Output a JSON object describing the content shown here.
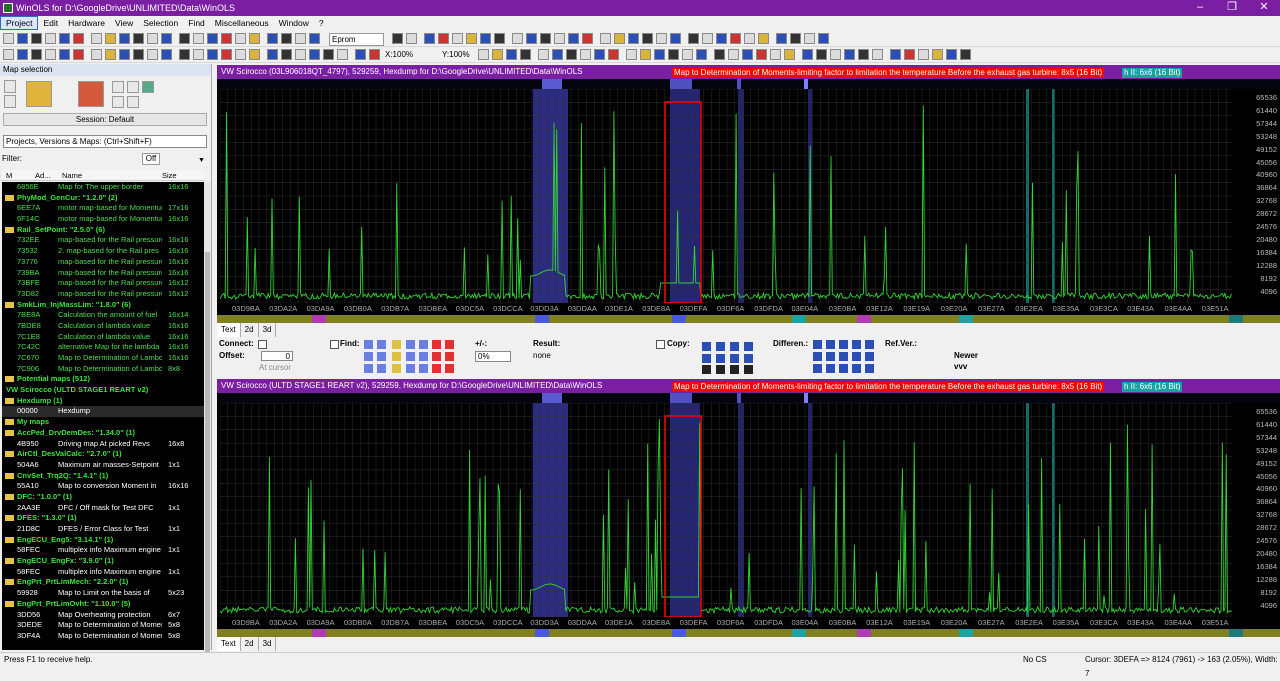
{
  "window": {
    "title": "WinOLS for D:\\GoogleDrive\\UNLIMITED\\Data\\WinOLS",
    "min": "–",
    "max": "❐",
    "close": "✕"
  },
  "menu": [
    "Project",
    "Edit",
    "Hardware",
    "View",
    "Selection",
    "Find",
    "Miscellaneous",
    "Window",
    "?"
  ],
  "toolbar": {
    "eprom": "Eprom",
    "xzoom": "X:100%",
    "yzoom": "Y:100%"
  },
  "left": {
    "header": "Map selection",
    "session": "Session: Default",
    "projsel": "Projects, Versions & Maps:  (Ctrl+Shift+F)",
    "filter_label": "Filter:",
    "filter_off": "Off",
    "cols": {
      "m": "M",
      "addr": "Ad...",
      "name": "Name",
      "size": "Size"
    },
    "rows": [
      {
        "k": "g",
        "a": "6856E",
        "n": "Map for The upper border",
        "s": "16x16"
      },
      {
        "k": "f",
        "t": "PhyMod_GenCur: \"1.2.0\" (2)"
      },
      {
        "k": "g",
        "a": "6EE7A",
        "n": "motor map-based for Momentum",
        "s": "17x16"
      },
      {
        "k": "g",
        "a": "6F14C",
        "n": "motor map-based for Momentum",
        "s": "16x16"
      },
      {
        "k": "f",
        "t": "Rail_SetPoint: \"2.5.0\" (6)"
      },
      {
        "k": "g",
        "a": "732EE",
        "n": "map-based for the Rail pressure",
        "s": "16x16"
      },
      {
        "k": "g",
        "a": "73532",
        "n": "2. map-based for the Rail pres",
        "s": "16x16"
      },
      {
        "k": "g",
        "a": "73776",
        "n": "map-based for the Rail pressure",
        "s": "16x16"
      },
      {
        "k": "g",
        "a": "739BA",
        "n": "map-based for the Rail pressure",
        "s": "16x16"
      },
      {
        "k": "g",
        "a": "73BFE",
        "n": "map-based for the Rail pressure",
        "s": "16x12"
      },
      {
        "k": "g",
        "a": "73D82",
        "n": "map-based for the Rail pressure",
        "s": "16x12"
      },
      {
        "k": "f",
        "t": "SmkLim_InjMassLim: \"1.8.0\" (6)"
      },
      {
        "k": "g",
        "a": "7BE8A",
        "n": "Calculation the amount of fuel",
        "s": "16x14"
      },
      {
        "k": "g",
        "a": "7BDE8",
        "n": "Calculation of lambda value",
        "s": "16x16"
      },
      {
        "k": "g",
        "a": "7C1E8",
        "n": "Calculation of lambda value",
        "s": "16x16"
      },
      {
        "k": "g",
        "a": "7C42C",
        "n": "alternative Map for the lambda",
        "s": "16x16"
      },
      {
        "k": "g",
        "a": "7C670",
        "n": "Map to Determination of Lambda",
        "s": "16x16"
      },
      {
        "k": "g",
        "a": "7C906",
        "n": "Map to Determination of Lambda",
        "s": "8x8"
      },
      {
        "k": "f",
        "t": "Potential maps (512)"
      },
      {
        "k": "h",
        "t": "VW Scirocco (ULTD STAGE1 REART v2)"
      },
      {
        "k": "f",
        "t": "Hexdump (1)"
      },
      {
        "k": "w",
        "a": "00000",
        "n": "Hexdump",
        "s": "",
        "sel": true
      },
      {
        "k": "f",
        "t": "My maps"
      },
      {
        "k": "f",
        "t": "AccPed_DrvDemDes: \"1.34.0\" (1)"
      },
      {
        "k": "w",
        "a": "4B950",
        "n": "Driving map At picked Revs",
        "s": "16x8"
      },
      {
        "k": "f",
        "t": "AirCtl_DesValCalc: \"2.7.0\" (1)"
      },
      {
        "k": "w",
        "a": "504A6",
        "n": "Maximum air masses-Setpoint",
        "s": "1x1"
      },
      {
        "k": "f",
        "t": "CnvSet_Trq2Q: \"1.4.1\" (1)"
      },
      {
        "k": "w",
        "a": "55A10",
        "n": "Map to conversion Moment in",
        "s": "16x16"
      },
      {
        "k": "f",
        "t": "DFC: \"1.0.0\" (1)"
      },
      {
        "k": "w",
        "a": "2AA3E",
        "n": "DFC / Off mask for Test DFC",
        "s": "1x1"
      },
      {
        "k": "f",
        "t": "DFES: \"1.3.0\" (1)"
      },
      {
        "k": "w",
        "a": "21D8C",
        "n": "DFES / Error Class for Test",
        "s": "1x1"
      },
      {
        "k": "f",
        "t": "EngECU_Eng5: \"3.14.1\" (1)"
      },
      {
        "k": "w",
        "a": "58FEC",
        "n": "multiplex info Maximum engine",
        "s": "1x1"
      },
      {
        "k": "f",
        "t": "EngECU_EngFx: \"3.9.0\" (1)"
      },
      {
        "k": "w",
        "a": "58FEC",
        "n": "multiplex info Maximum engine",
        "s": "1x1"
      },
      {
        "k": "f",
        "t": "EngPrt_PrtLimMech: \"2.2.0\" (1)"
      },
      {
        "k": "w",
        "a": "59928",
        "n": "Map to Limit on the basis of",
        "s": "5x23"
      },
      {
        "k": "f",
        "t": "EngPrt_PrtLimOvht: \"1.10.0\" (5)"
      },
      {
        "k": "w",
        "a": "3DD56",
        "n": "Map Overheating protection",
        "s": "6x7"
      },
      {
        "k": "w",
        "a": "3DEDE",
        "n": "Map to Determination of Moment",
        "s": "5x8"
      },
      {
        "k": "w",
        "a": "3DF4A",
        "n": "Map to Determination of Moment",
        "s": "5x8"
      }
    ]
  },
  "panel1": {
    "title": "VW Scirocco (03L906018QT_4797), 529259, Hexdump for D:\\GoogleDrive\\UNLIMITED\\Data\\WinOLS"
  },
  "panel2": {
    "title": "VW Scirocco (ULTD STAGE1 REART v2), 529259, Hexdump for D:\\GoogleDrive\\UNLIMITED\\Data\\WinOLS"
  },
  "maplabel": "Map to Determination of Moments-limiting factor to limitation the temperature Before the exhaust gas turbine: 8x5 (16 Bit)",
  "maplabel2": "h II: 6x6 (16 Bit)",
  "yticks": [
    "65536",
    "61440",
    "57344",
    "53248",
    "49152",
    "45056",
    "40960",
    "36864",
    "32768",
    "28672",
    "24576",
    "20480",
    "16384",
    "12288",
    "8192",
    "4096"
  ],
  "xticks": [
    "03D9BA",
    "03DA2A",
    "03DA9A",
    "03DB0A",
    "03DB7A",
    "03DBEA",
    "03DC5A",
    "03DCCA",
    "03DD3A",
    "03DDAA",
    "03DE1A",
    "03DE8A",
    "03DEFA",
    "03DF6A",
    "03DFDA",
    "03E04A",
    "03E0BA",
    "03E12A",
    "03E19A",
    "03E20A",
    "03E27A",
    "03E2EA",
    "03E35A",
    "03E3CA",
    "03E43A",
    "03E4AA",
    "03E51A"
  ],
  "tabs": [
    "Text",
    "2d",
    "3d"
  ],
  "ctrl": {
    "connect": "Connect:",
    "offset": "Offset:",
    "offval": "0",
    "atcursor": "At cursor",
    "find": "Find:",
    "plusminus": "+/-:",
    "pct": "0%",
    "result": "Result:",
    "none": "none",
    "copy": "Copy:",
    "differen": "Differen.:",
    "refver": "Ref.Ver.:",
    "newer": "Newer",
    "vvv": "vvv"
  },
  "status": {
    "help": "Press F1 to receive help.",
    "cs": "No CS",
    "cursor": "Cursor: 3DEFA => 8124 (7961) -> 163 (2.05%), Width: 7"
  },
  "colors": {
    "title": "#7a1fa2",
    "plot": "#35d335",
    "grid": "#3a3a3a",
    "highlight": "#3a3aa0",
    "red": "#ff0000",
    "cyan": "#17a3a3"
  }
}
